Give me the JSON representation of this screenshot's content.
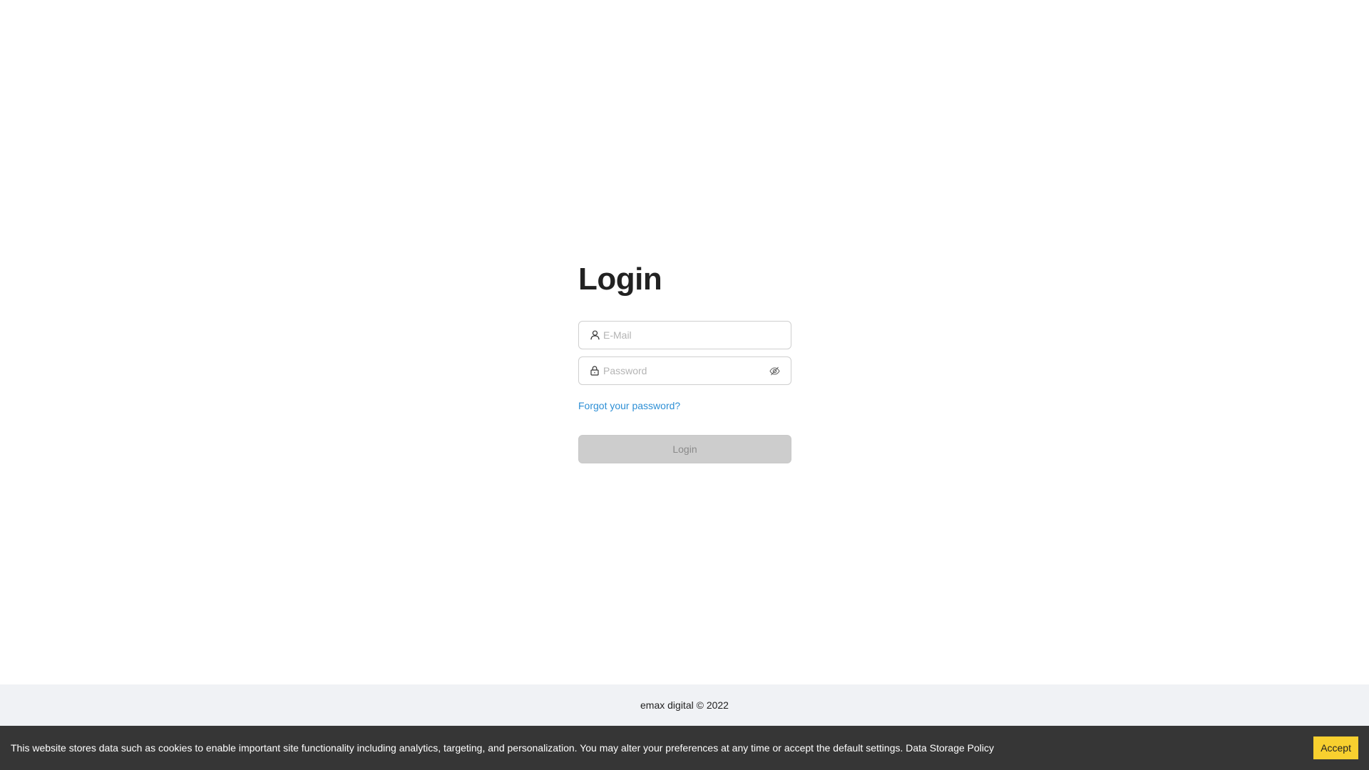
{
  "login": {
    "title": "Login",
    "email_placeholder": "E-Mail",
    "password_placeholder": "Password",
    "forgot_password": "Forgot your password?",
    "submit_label": "Login"
  },
  "footer": {
    "copyright": "emax digital © 2022"
  },
  "cookie_banner": {
    "message": "This website stores data such as cookies to enable important site functionality including analytics, targeting, and personalization. You may alter your preferences at any time or accept the default settings.",
    "policy_link": "Data Storage Policy",
    "accept_label": "Accept"
  },
  "icons": {
    "email_field": "user-icon",
    "password_field": "lock-icon",
    "password_toggle": "eye-slash-icon"
  },
  "colors": {
    "link": "#2d8fd5",
    "accept_button": "#f8d02f",
    "cookie_bar": "#363636",
    "footer": "#f0f2f5",
    "disabled_button": "#cdcdcd"
  }
}
